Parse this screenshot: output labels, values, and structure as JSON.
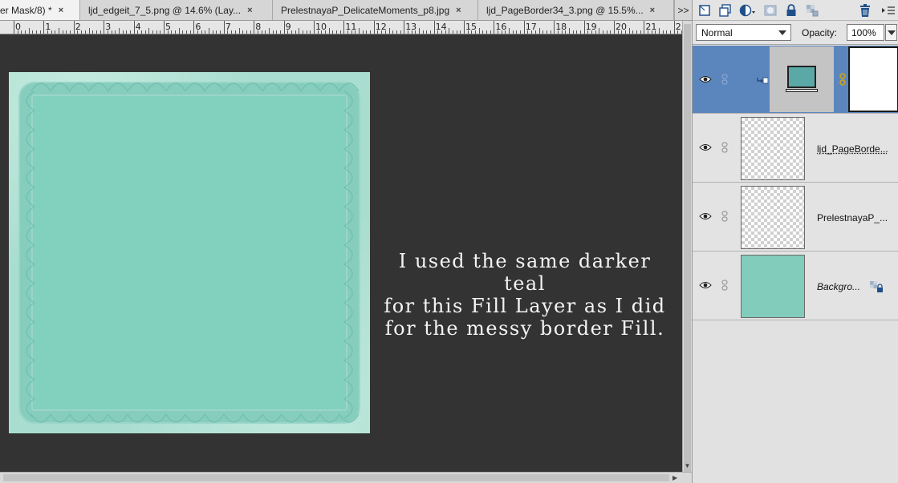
{
  "tabs": [
    {
      "label": "er Mask/8) *",
      "close": "×",
      "active": true
    },
    {
      "label": "ljd_edgeit_7_5.png @ 14.6% (Lay...",
      "close": "×",
      "active": false
    },
    {
      "label": "PrelestnayaP_DelicateMoments_p8.jpg",
      "close": "×",
      "active": false
    },
    {
      "label": "ljd_PageBorder34_3.png @ 15.5%...",
      "close": "×",
      "active": false
    }
  ],
  "tabs_overflow": ">>",
  "ruler": {
    "numbers": [
      "0",
      "1",
      "2",
      "3",
      "4",
      "5",
      "6",
      "7",
      "8",
      "9",
      "10",
      "11",
      "12",
      "13",
      "14",
      "15",
      "16",
      "17",
      "18",
      "19",
      "20",
      "21",
      "2"
    ]
  },
  "caption": {
    "line1": "I used the same darker teal",
    "line2": "for this Fill Layer as I did",
    "line3": "for the messy border Fill."
  },
  "layers_panel": {
    "blend_mode": "Normal",
    "opacity_label": "Opacity:",
    "opacity_value": "100%",
    "layers": [
      {
        "name": "",
        "type": "fill",
        "selected": true
      },
      {
        "name": "ljd_PageBorde...",
        "type": "pixel",
        "selected": false
      },
      {
        "name": "PrelestnayaP_...",
        "type": "pixel",
        "selected": false
      },
      {
        "name": "Backgro...",
        "type": "background",
        "selected": false,
        "locked": true
      }
    ]
  },
  "colors": {
    "canvas_bg": "#333333",
    "fill_teal": "#82d0be",
    "selected_layer": "#5b86bd"
  }
}
